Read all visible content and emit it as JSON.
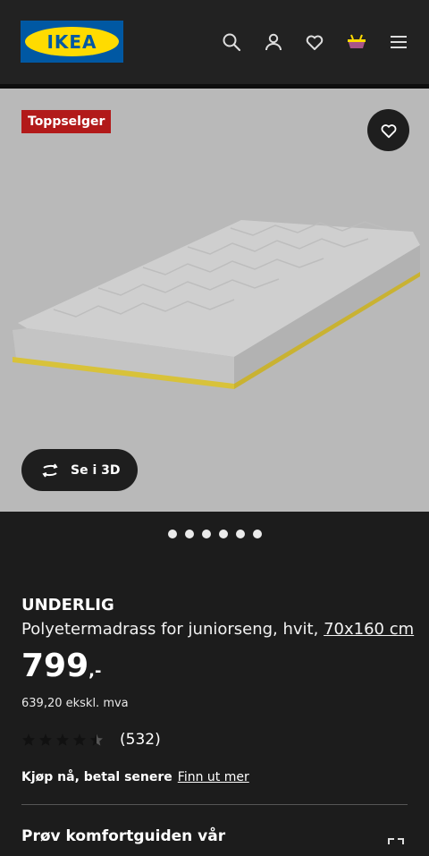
{
  "header": {
    "logo_text": "IKEA",
    "icons": [
      "search-icon",
      "account-icon",
      "wishlist-heart-icon",
      "cart-icon",
      "menu-icon"
    ]
  },
  "product_image": {
    "badge": "Toppselger",
    "view_3d_label": "Se i 3D"
  },
  "carousel": {
    "dot_count": 6
  },
  "product": {
    "name": "UNDERLIG",
    "description": "Polyetermadrass for juniorseng, hvit,",
    "size": "70x160 cm",
    "price": "799",
    "price_suffix": ",-",
    "price_ex_vat": "639,20 ekskl. mva",
    "rating": 4.5,
    "review_count": "(532)"
  },
  "financing": {
    "text": "Kjøp nå, betal senere",
    "link": "Finn ut mer"
  },
  "comfort_guide": {
    "label": "Prøv komfortguiden vår"
  },
  "colors": {
    "background": "#1c1c1c",
    "header": "#222222",
    "ikea_blue": "#0058a3",
    "ikea_yellow": "#ffdb00",
    "badge_red": "#b21a1a"
  }
}
